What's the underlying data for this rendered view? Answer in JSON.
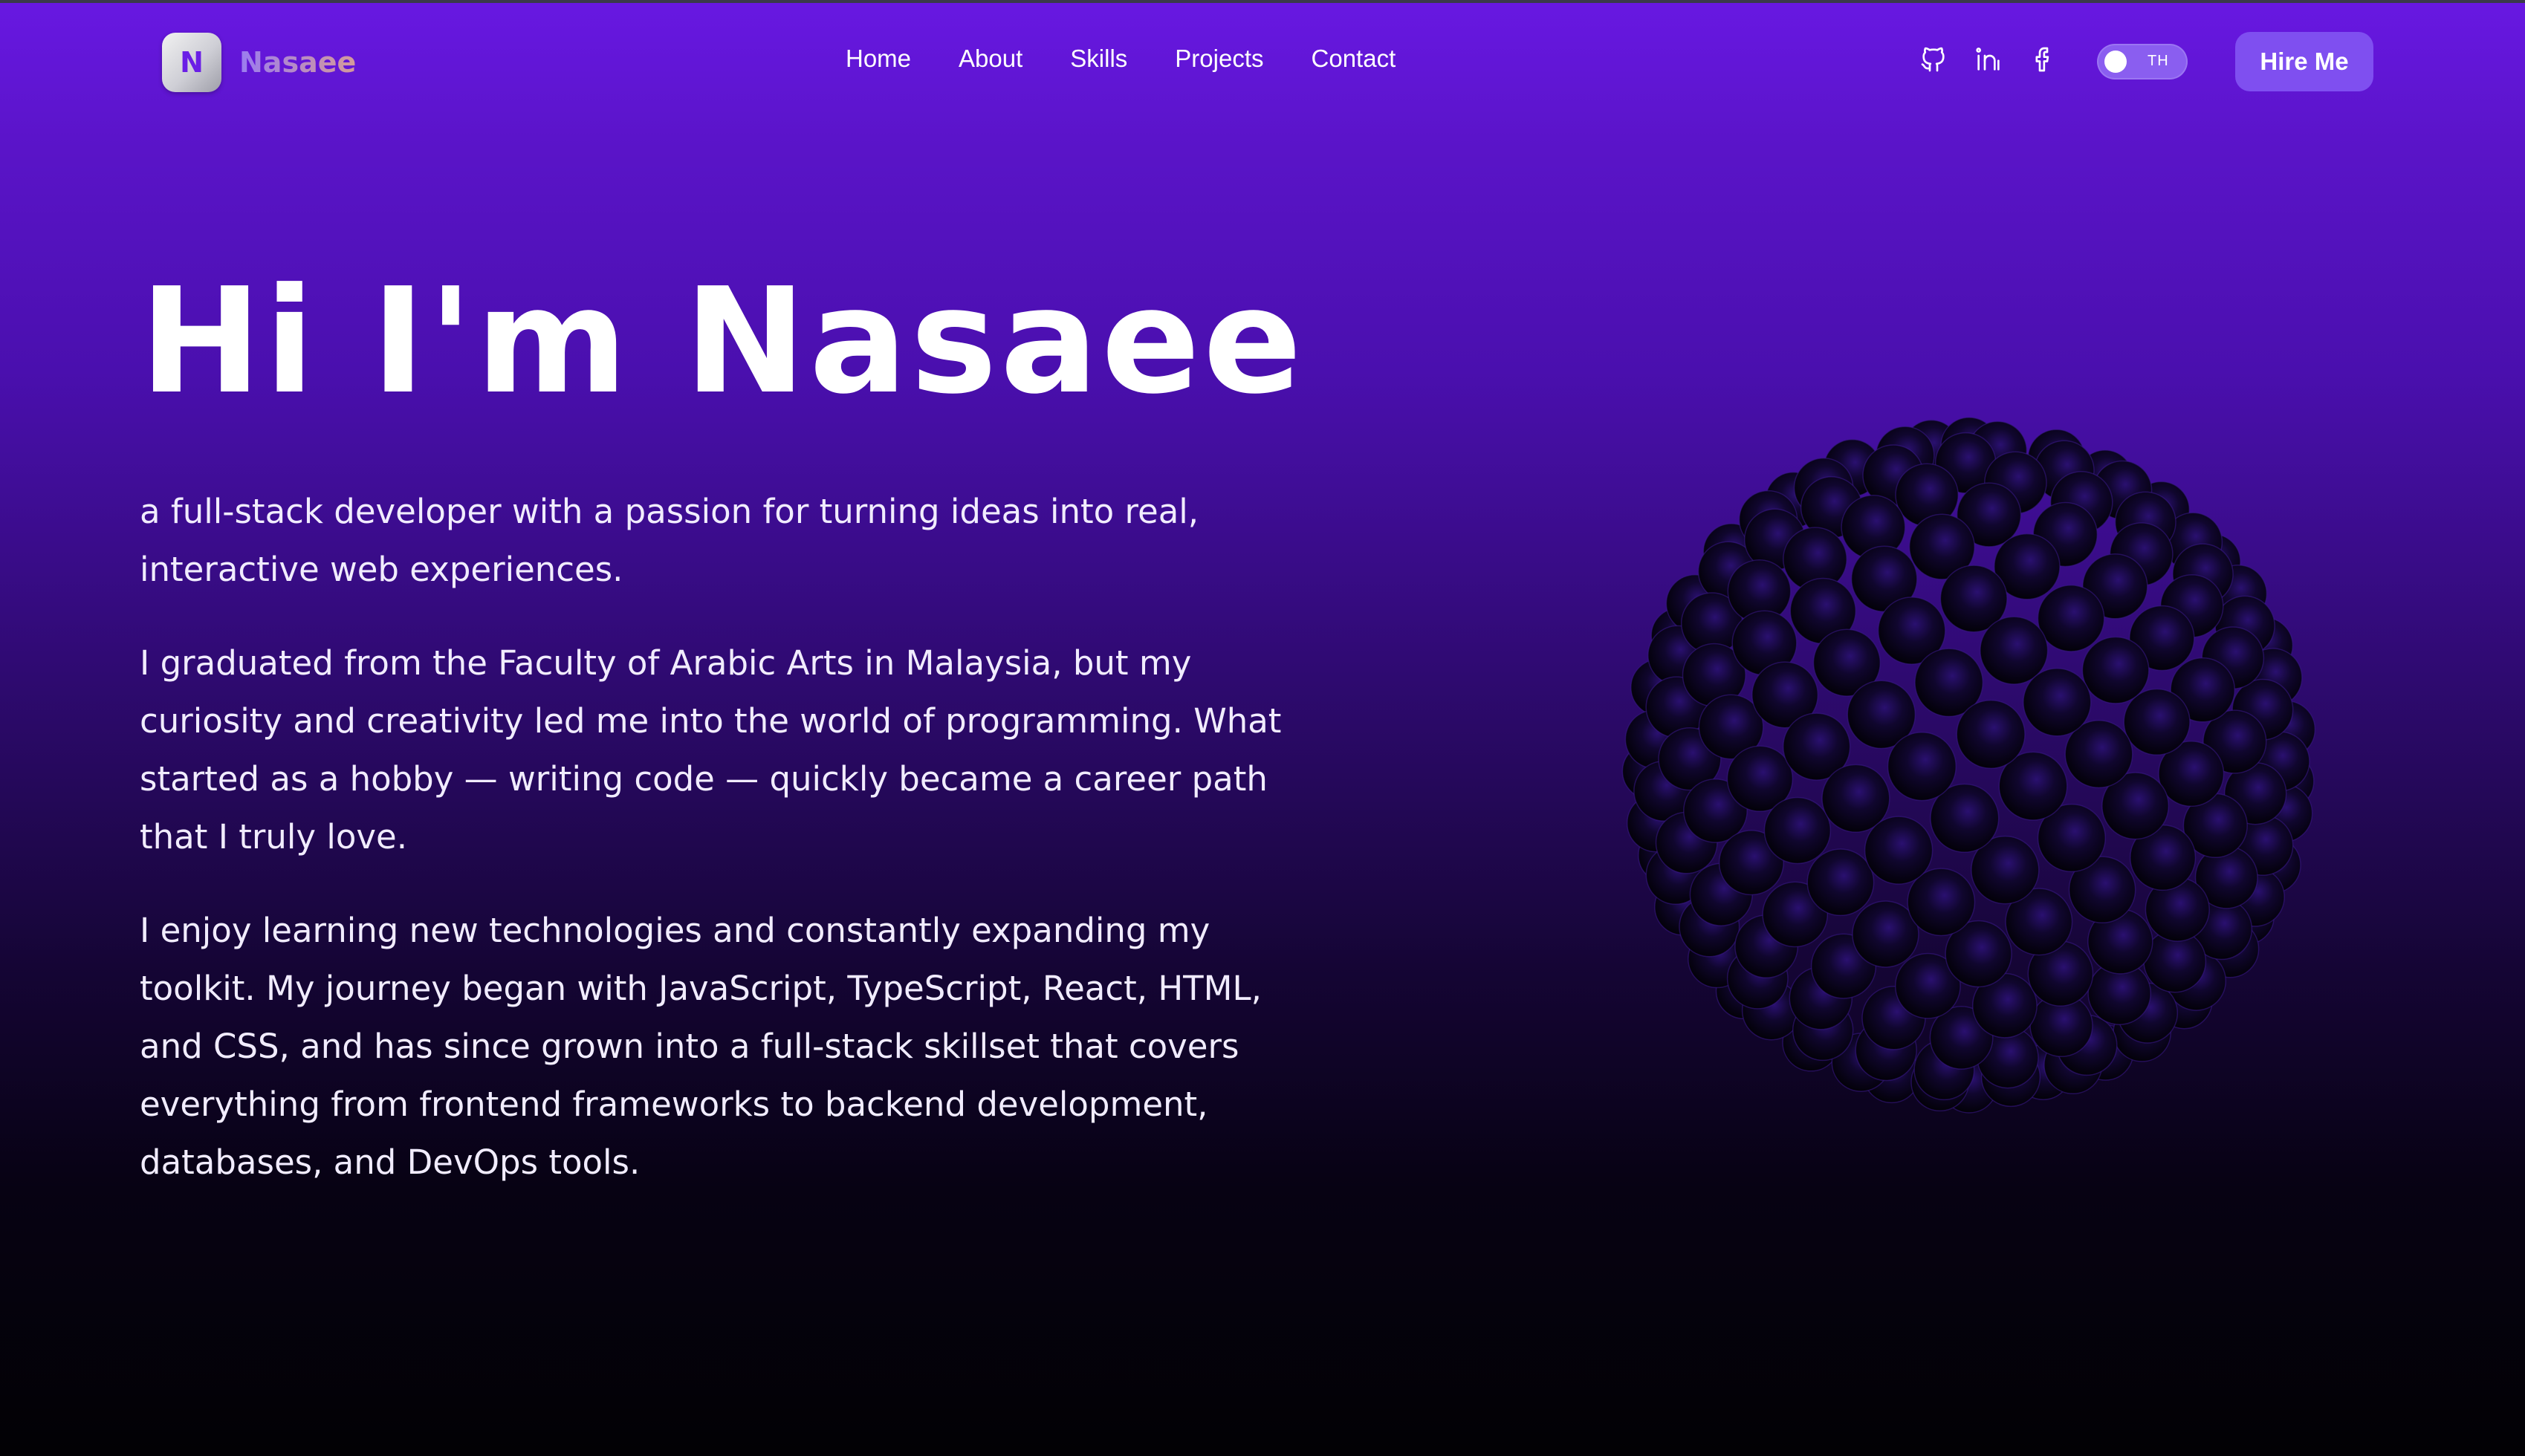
{
  "brand": {
    "logo_letter": "N",
    "name": "Nasaee"
  },
  "nav": {
    "items": [
      "Home",
      "About",
      "Skills",
      "Projects",
      "Contact"
    ]
  },
  "socials": [
    "github-icon",
    "linkedin-icon",
    "facebook-icon"
  ],
  "language_toggle": {
    "label": "TH"
  },
  "hire_button": "Hire Me",
  "hero": {
    "title": "Hi I'm Nasaee",
    "paragraph_1": "a full-stack developer with a passion for turning ideas into real, interactive web experiences.",
    "paragraph_2": "I graduated from the Faculty of Arabic Arts in Malaysia, but my curiosity and creativity led me into the world of programming. What started as a hobby — writing code — quickly became a career path that I truly love.",
    "paragraph_3": "I enjoy learning new technologies and constantly expanding my toolkit. My journey began with JavaScript, TypeScript, React, HTML, and CSS, and has since grown into a full-stack skillset that covers everything from frontend frameworks to backend development, databases, and DevOps tools."
  },
  "colors": {
    "accent": "#6a1ee6",
    "button": "#7f4ff0",
    "background_top": "#6818e2",
    "background_bottom": "#020104"
  }
}
